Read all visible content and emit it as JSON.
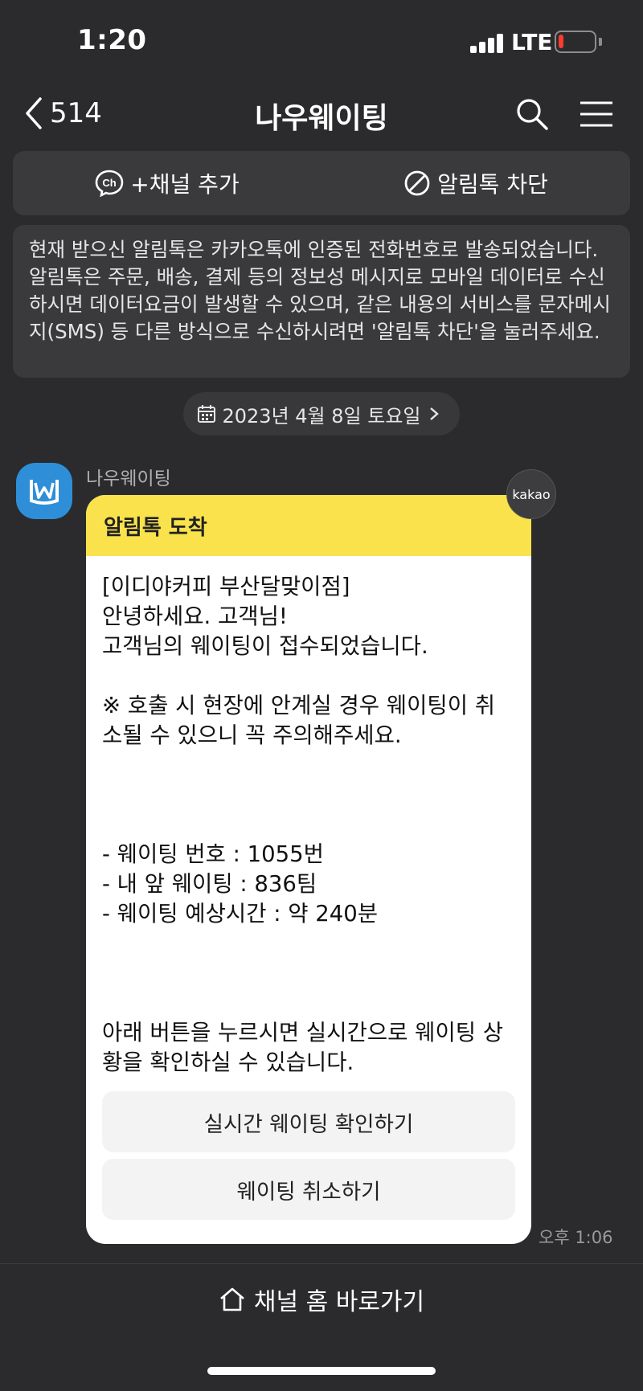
{
  "status_bar": {
    "time": "1:20",
    "network": "LTE",
    "battery_level": 0.15
  },
  "nav": {
    "back_count": "514",
    "title": "나우웨이팅"
  },
  "actions": {
    "add_channel": "+채널 추가",
    "block_alimtalk": "알림톡 차단"
  },
  "notice": {
    "text": "현재 받으신 알림톡은 카카오톡에 인증된 전화번호로 발송되었습니다. 알림톡은 주문, 배송, 결제 등의 정보성 메시지로 모바일 데이터로 수신하시면 데이터요금이 발생할 수 있으며, 같은 내용의 서비스를 문자메시지(SMS) 등 다른 방식으로 수신하시려면 '알림톡 차단'을 눌러주세요."
  },
  "date": {
    "label": "2023년 4월 8일 토요일"
  },
  "message": {
    "sender": "나우웨이팅",
    "badge": "kakao",
    "header": "알림톡 도착",
    "body": "[이디야커피 부산달맞이점]\n안녕하세요. 고객님!\n고객님의 웨이팅이 접수되었습니다.\n\n※ 호출 시 현장에 안계실 경우 웨이팅이 취소될 수 있으니 꼭 주의해주세요.\n\n\n\n- 웨이팅 번호 : 1055번\n- 내 앞 웨이팅 : 836팀\n- 웨이팅 예상시간 : 약 240분\n\n\n\n아래 버튼을 누르시면 실시간으로 웨이팅 상황을 확인하실 수 있습니다.",
    "button_check": "실시간 웨이팅 확인하기",
    "button_cancel": "웨이팅 취소하기",
    "time": "오후 1:06"
  },
  "bottom": {
    "channel_home": "채널 홈 바로가기"
  },
  "colors": {
    "background": "#2b2b2d",
    "header_yellow": "#f9e24c",
    "avatar_blue": "#2e8fd8",
    "battery_red": "#ff3b30"
  }
}
